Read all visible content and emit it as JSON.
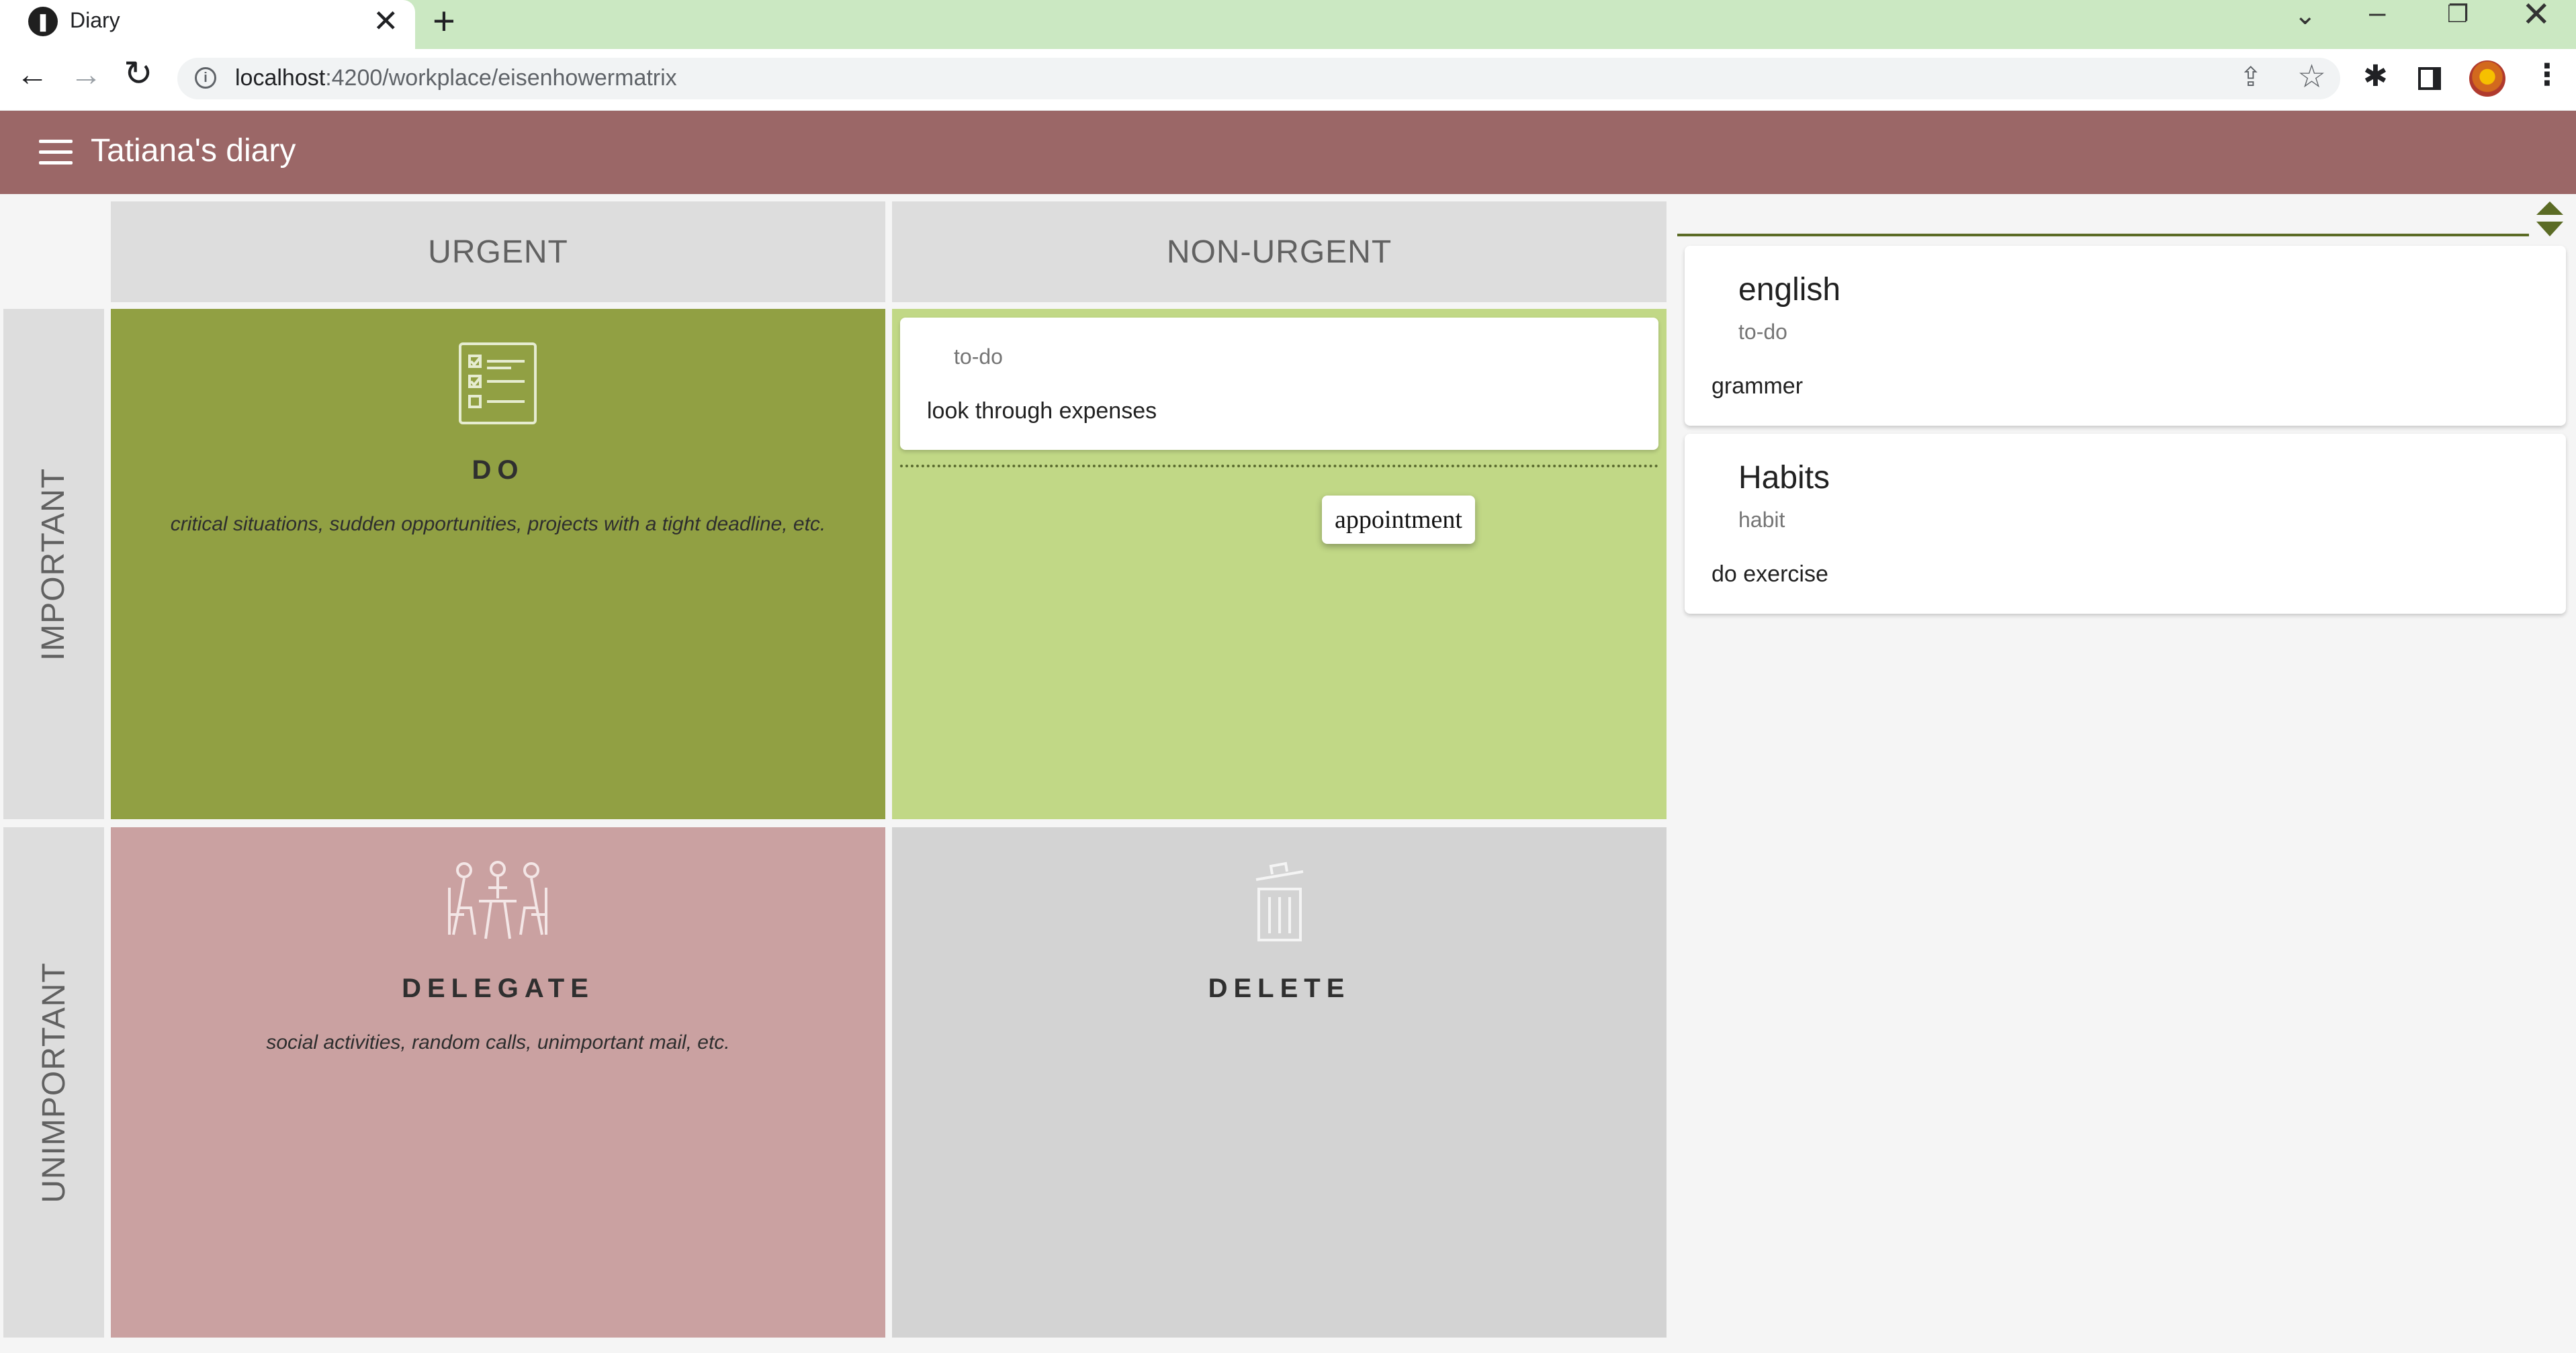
{
  "browser": {
    "tab_title": "Diary",
    "tab_favicon": "book-icon",
    "url_host": "localhost",
    "url_path": ":4200/workplace/eisenhowermatrix",
    "icons": {
      "close": "✕",
      "new_tab": "+",
      "tablist": "⌄",
      "minimize": "–",
      "restore": "❐",
      "window_close": "✕",
      "back": "←",
      "forward": "→",
      "reload": "↻",
      "share": "⇪",
      "star": "☆",
      "extensions": "✱",
      "kebab": "⋮",
      "info": "i"
    }
  },
  "app": {
    "title": "Tatiana's diary",
    "header_color": "#9b6767"
  },
  "matrix": {
    "columns": [
      "URGENT",
      "NON-URGENT"
    ],
    "rows": [
      "IMPORTANT",
      "UNIMPORTANT"
    ],
    "quadrants": {
      "do": {
        "title": "DO",
        "description": "critical situations, sudden opportunities, projects with a tight deadline, etc.",
        "icon": "checklist-icon",
        "color": "#91a043"
      },
      "plan": {
        "color": "#c1d886",
        "card": {
          "category": "to-do",
          "text": "look through expenses"
        },
        "dragged_item": "appointment"
      },
      "delegate": {
        "title": "DELEGATE",
        "description": "social activities, random calls, unimportant mail, etc.",
        "icon": "meeting-icon",
        "color": "#caa1a1"
      },
      "delete": {
        "title": "DELETE",
        "icon": "trash-icon",
        "color": "#d3d3d3"
      }
    }
  },
  "sidebar": {
    "accent": "#5b6b25",
    "cards": [
      {
        "title": "english",
        "category": "to-do",
        "text": "grammer"
      },
      {
        "title": "Habits",
        "category": "habit",
        "text": "do exercise"
      }
    ]
  }
}
